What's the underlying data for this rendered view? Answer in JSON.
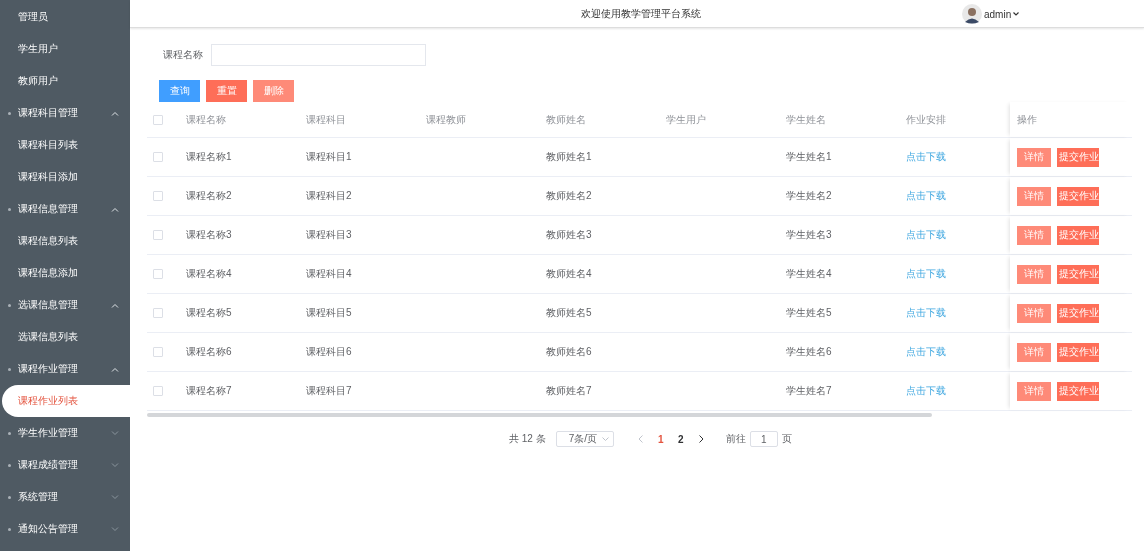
{
  "header": {
    "title": "欢迎使用教学管理平台系统",
    "user": "admin"
  },
  "sidebar": [
    {
      "kind": "item",
      "label": "管理员",
      "selected": false
    },
    {
      "kind": "item",
      "label": "学生用户",
      "selected": false
    },
    {
      "kind": "item",
      "label": "教师用户",
      "selected": false
    },
    {
      "kind": "group",
      "label": "课程科目管理",
      "expanded": true,
      "children": [
        {
          "label": "课程科目列表",
          "selected": false
        },
        {
          "label": "课程科目添加",
          "selected": false
        }
      ]
    },
    {
      "kind": "group",
      "label": "课程信息管理",
      "expanded": true,
      "children": [
        {
          "label": "课程信息列表",
          "selected": false
        },
        {
          "label": "课程信息添加",
          "selected": false
        }
      ]
    },
    {
      "kind": "group",
      "label": "选课信息管理",
      "expanded": true,
      "children": [
        {
          "label": "选课信息列表",
          "selected": false
        }
      ]
    },
    {
      "kind": "group",
      "label": "课程作业管理",
      "expanded": true,
      "children": [
        {
          "label": "课程作业列表",
          "selected": true
        }
      ]
    },
    {
      "kind": "group",
      "label": "学生作业管理",
      "expanded": false
    },
    {
      "kind": "group",
      "label": "课程成绩管理",
      "expanded": false
    },
    {
      "kind": "group",
      "label": "系统管理",
      "expanded": false
    },
    {
      "kind": "group",
      "label": "通知公告管理",
      "expanded": false
    }
  ],
  "search": {
    "label": "课程名称"
  },
  "buttons": [
    {
      "label": "查询",
      "kind": "primary"
    },
    {
      "label": "重置",
      "kind": "danger"
    },
    {
      "label": "删除",
      "kind": "light"
    }
  ],
  "table": {
    "all_checked": false,
    "columns": [
      "课程名称",
      "课程科目",
      "课程教师",
      "教师姓名",
      "学生用户",
      "学生姓名",
      "作业安排",
      "操作"
    ],
    "rows": [
      {
        "checked": false,
        "course": "课程名称1",
        "subject": "课程科目1",
        "teacher_name": "教师姓名1",
        "student_name": "学生姓名1",
        "homework": "点击下载",
        "actions": [
          "详情",
          "提交作业"
        ]
      },
      {
        "checked": false,
        "course": "课程名称2",
        "subject": "课程科目2",
        "teacher_name": "教师姓名2",
        "student_name": "学生姓名2",
        "homework": "点击下载",
        "actions": [
          "详情",
          "提交作业"
        ]
      },
      {
        "checked": false,
        "course": "课程名称3",
        "subject": "课程科目3",
        "teacher_name": "教师姓名3",
        "student_name": "学生姓名3",
        "homework": "点击下载",
        "actions": [
          "详情",
          "提交作业"
        ]
      },
      {
        "checked": false,
        "course": "课程名称4",
        "subject": "课程科目4",
        "teacher_name": "教师姓名4",
        "student_name": "学生姓名4",
        "homework": "点击下载",
        "actions": [
          "详情",
          "提交作业"
        ]
      },
      {
        "checked": false,
        "course": "课程名称5",
        "subject": "课程科目5",
        "teacher_name": "教师姓名5",
        "student_name": "学生姓名5",
        "homework": "点击下载",
        "actions": [
          "详情",
          "提交作业"
        ]
      },
      {
        "checked": false,
        "course": "课程名称6",
        "subject": "课程科目6",
        "teacher_name": "教师姓名6",
        "student_name": "学生姓名6",
        "homework": "点击下载",
        "actions": [
          "详情",
          "提交作业"
        ]
      },
      {
        "checked": false,
        "course": "课程名称7",
        "subject": "课程科目7",
        "teacher_name": "教师姓名7",
        "student_name": "学生姓名7",
        "homework": "点击下载",
        "actions": [
          "详情",
          "提交作业"
        ]
      }
    ]
  },
  "pagination": {
    "total": "共 12 条",
    "page_size": "7条/页",
    "pages": [
      {
        "label": "1",
        "selected": true
      },
      {
        "label": "2",
        "selected": false
      }
    ],
    "goto_label": "前往",
    "goto_value": "1",
    "goto_suffix": "页"
  }
}
